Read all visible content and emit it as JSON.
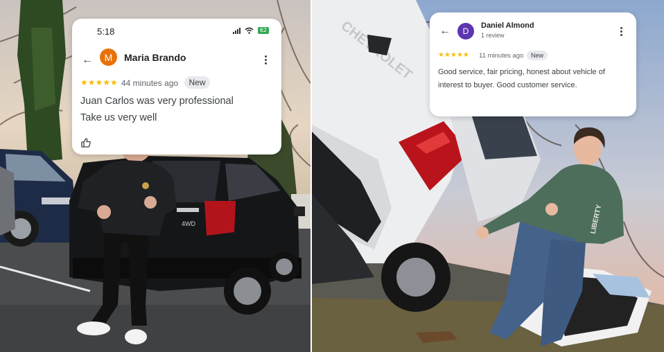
{
  "left_review": {
    "status_time": "5:18",
    "battery": "62",
    "avatar_letter": "M",
    "name": "Maria Brando",
    "stars": "★★★★★",
    "time_ago": "44 minutes ago",
    "badge": "New",
    "text_line1": "Juan Carlos was very professional",
    "text_line2": "Take us very well",
    "colors": {
      "avatar": "#e8710a",
      "stars": "#fbbc04",
      "badge_bg": "#e8eaed"
    }
  },
  "right_review": {
    "avatar_letter": "D",
    "name": "Daniel Almond",
    "review_count": "1 review",
    "stars": "★★★★★",
    "time_ago": "11 minutes ago",
    "badge": "New",
    "text_line1": "Good service, fair pricing, honest about vehicle of",
    "text_line2": "interest to buyer. Good customer service.",
    "colors": {
      "avatar": "#5e35b1",
      "stars": "#fbbc04",
      "badge_bg": "#e8eaed"
    }
  },
  "photos": {
    "left_vehicle_badge": "4WD",
    "right_tailgate_text": "CHEVROLET",
    "right_hoodie_text": "LIBERTY"
  }
}
